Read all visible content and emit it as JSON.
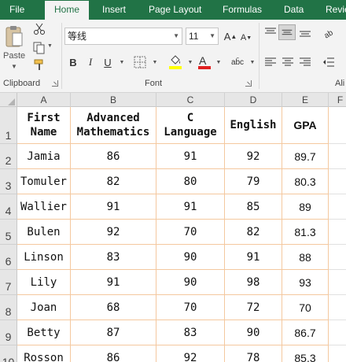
{
  "ribbon_tabs": [
    "File",
    "Home",
    "Insert",
    "Page Layout",
    "Formulas",
    "Data",
    "Revie"
  ],
  "clipboard": {
    "paste_label": "Paste",
    "group_label": "Clipboard"
  },
  "font": {
    "name": "等线",
    "size": "11",
    "group_label": "Font"
  },
  "alignment": {
    "group_label": "Ali"
  },
  "icons": {
    "paste": "paste-icon",
    "cut": "scissors-icon",
    "copy": "copy-icon",
    "format_painter": "format-painter-icon",
    "increase_font": "increase-font-size-icon",
    "decrease_font": "decrease-font-size-icon",
    "bold": "bold-icon",
    "italic": "italic-icon",
    "underline": "underline-icon",
    "borders": "borders-icon",
    "fill_color": "fill-color-icon",
    "font_color": "font-color-icon",
    "phonetic": "phonetic-guide-icon",
    "align_top": "align-top-icon",
    "align_middle": "align-middle-icon",
    "align_bottom": "align-bottom-icon",
    "align_left": "align-left-icon",
    "align_center": "align-center-icon",
    "align_right": "align-right-icon"
  },
  "colors": {
    "ribbon_green": "#217346",
    "fill_highlight": "#ffff00",
    "font_color_red": "#e02020",
    "cell_border": "#f4c89f"
  },
  "grid": {
    "columns": [
      "A",
      "B",
      "C",
      "D",
      "E",
      "F"
    ],
    "row_numbers": [
      "1",
      "2",
      "3",
      "4",
      "5",
      "6",
      "7",
      "8",
      "9",
      "10"
    ],
    "headers": [
      "First\nName",
      "Advanced\nMathematics",
      "C\nLanguage",
      "English",
      "GPA"
    ],
    "rows": [
      [
        "Jamia",
        "86",
        "91",
        "92",
        "89.7"
      ],
      [
        "Tomuler",
        "82",
        "80",
        "79",
        "80.3"
      ],
      [
        "Wallier",
        "91",
        "91",
        "85",
        "89"
      ],
      [
        "Bulen",
        "92",
        "70",
        "82",
        "81.3"
      ],
      [
        "Linson",
        "83",
        "90",
        "91",
        "88"
      ],
      [
        "Lily",
        "91",
        "90",
        "98",
        "93"
      ],
      [
        "Joan",
        "68",
        "70",
        "72",
        "70"
      ],
      [
        "Betty",
        "87",
        "83",
        "90",
        "86.7"
      ],
      [
        "Rosson",
        "86",
        "92",
        "78",
        "85.3"
      ]
    ]
  }
}
